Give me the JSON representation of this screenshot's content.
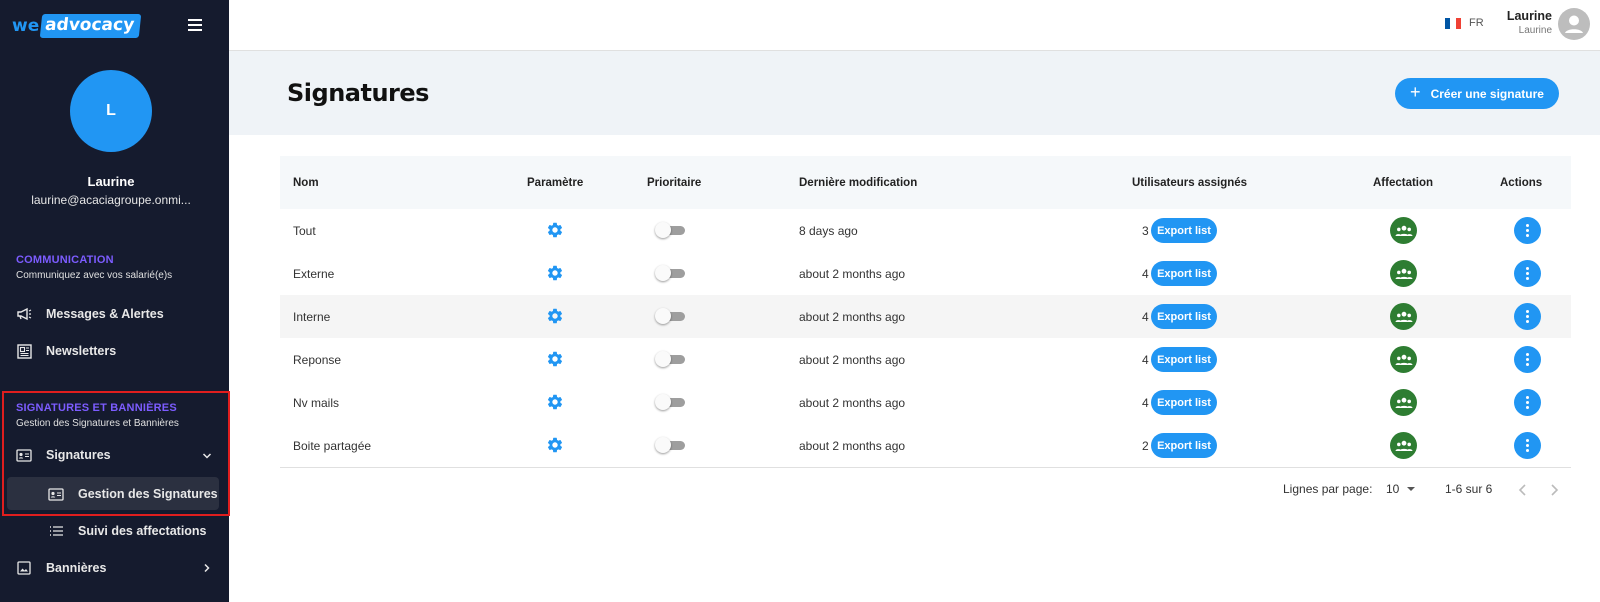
{
  "brand": {
    "we": "we",
    "advocacy": "advocacy"
  },
  "profile": {
    "initial": "L",
    "name": "Laurine",
    "email": "laurine@acaciagroupe.onmi..."
  },
  "sidebar": {
    "communication": {
      "title": "COMMUNICATION",
      "subtitle": "Communiquez avec vos salarié(e)s",
      "items": [
        {
          "label": "Messages & Alertes",
          "icon": "megaphone-icon"
        },
        {
          "label": "Newsletters",
          "icon": "newspaper-icon"
        }
      ]
    },
    "signatures": {
      "title": "SIGNATURES ET BANNIÈRES",
      "subtitle": "Gestion des Signatures et Bannières",
      "items": [
        {
          "label": "Signatures",
          "icon": "id-card-icon"
        },
        {
          "label": "Gestion des Signatures",
          "icon": "id-card-icon"
        },
        {
          "label": "Suivi des affectations",
          "icon": "list-icon"
        },
        {
          "label": "Bannières",
          "icon": "image-icon"
        }
      ]
    }
  },
  "topbar": {
    "lang": "FR",
    "user_name": "Laurine",
    "user_sub": "Laurine"
  },
  "page": {
    "title": "Signatures",
    "create_label": "Créer une signature"
  },
  "table": {
    "headers": {
      "nom": "Nom",
      "parametre": "Paramètre",
      "prioritaire": "Prioritaire",
      "modif": "Dernière modification",
      "users": "Utilisateurs assignés",
      "affectation": "Affectation",
      "actions": "Actions"
    },
    "export_label": "Export list",
    "rows": [
      {
        "nom": "Tout",
        "modif": "8 days ago",
        "count": "3",
        "prioritaire": false
      },
      {
        "nom": "Externe",
        "modif": "about 2 months ago",
        "count": "4",
        "prioritaire": false
      },
      {
        "nom": "Interne",
        "modif": "about 2 months ago",
        "count": "4",
        "prioritaire": false
      },
      {
        "nom": "Reponse",
        "modif": "about 2 months ago",
        "count": "4",
        "prioritaire": false
      },
      {
        "nom": "Nv mails",
        "modif": "about 2 months ago",
        "count": "4",
        "prioritaire": false
      },
      {
        "nom": "Boite partagée",
        "modif": "about 2 months ago",
        "count": "2",
        "prioritaire": false
      }
    ]
  },
  "pagination": {
    "rows_label": "Lignes par page:",
    "rows_value": "10",
    "range": "1-6 sur 6"
  },
  "colors": {
    "sidebar": "#151b2e",
    "accent": "#2196f3",
    "section": "#7c5cff",
    "affectation": "#2e7d32",
    "highlight": "#e01e1e"
  }
}
